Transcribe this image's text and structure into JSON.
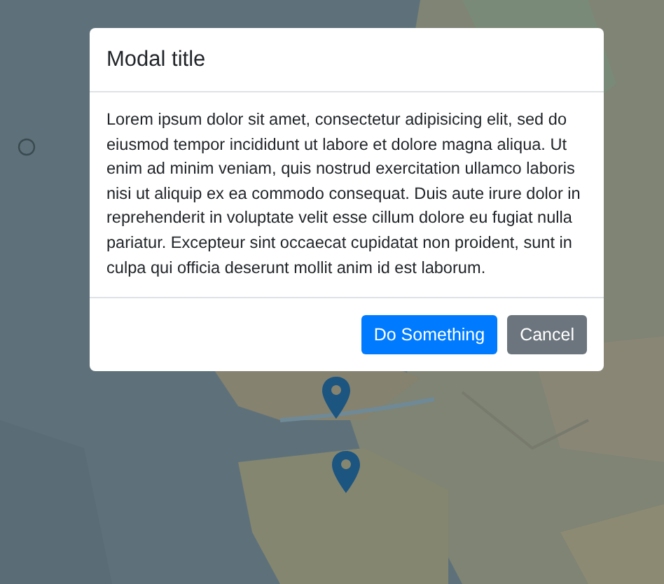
{
  "modal": {
    "title": "Modal title",
    "body": "Lorem ipsum dolor sit amet, consectetur adipisicing elit, sed do eiusmod tempor incididunt ut labore et dolore magna aliqua. Ut enim ad minim veniam, quis nostrud exercitation ullamco laboris nisi ut aliquip ex ea commodo consequat. Duis aute irure dolor in reprehenderit in voluptate velit esse cillum dolore eu fugiat nulla pariatur. Excepteur sint occaecat cupidatat non proident, sunt in culpa qui officia deserunt mollit anim id est laborum.",
    "buttons": [
      {
        "label": "Do Something",
        "kind": "primary"
      },
      {
        "label": "Cancel",
        "kind": "secondary"
      }
    ]
  }
}
